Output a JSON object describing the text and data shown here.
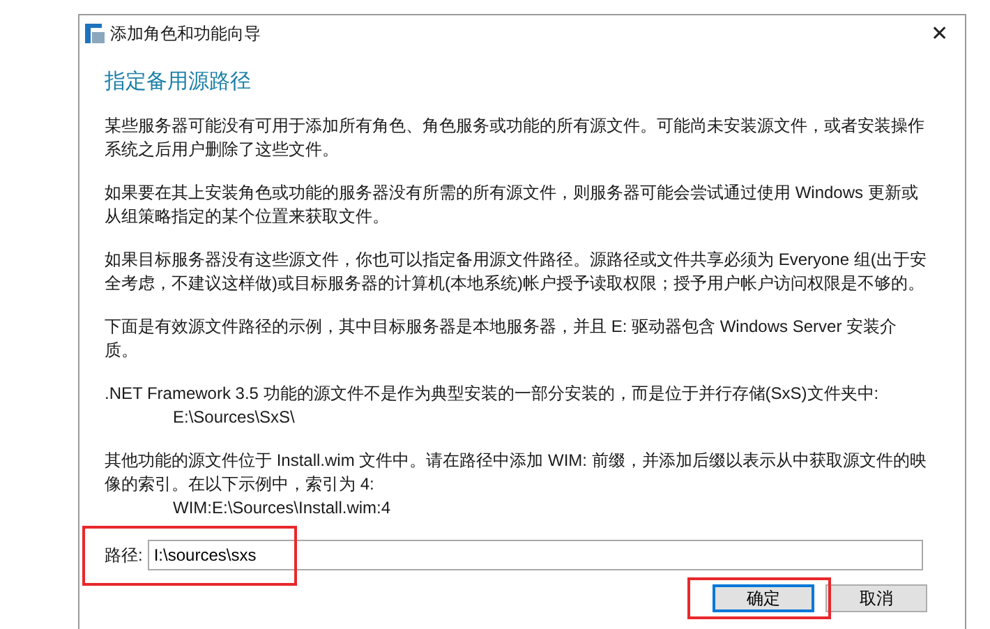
{
  "window": {
    "title": "添加角色和功能向导",
    "close": "✕"
  },
  "heading": "指定备用源路径",
  "paragraphs": [
    {
      "kind": "text",
      "text": "某些服务器可能没有可用于添加所有角色、角色服务或功能的所有源文件。可能尚未安装源文件，或者安装操作系统之后用户删除了这些文件。"
    },
    {
      "kind": "text",
      "text": "如果要在其上安装角色或功能的服务器没有所需的所有源文件，则服务器可能会尝试通过使用 Windows 更新或从组策略指定的某个位置来获取文件。"
    },
    {
      "kind": "text",
      "text": "如果目标服务器没有这些源文件，你也可以指定备用源文件路径。源路径或文件共享必须为 Everyone 组(出于安全考虑，不建议这样做)或目标服务器的计算机(本地系统)帐户授予读取权限；授予用户帐户访问权限是不够的。"
    },
    {
      "kind": "text",
      "text": "下面是有效源文件路径的示例，其中目标服务器是本地服务器，并且 E: 驱动器包含 Windows Server 安装介质。"
    },
    {
      "kind": "example",
      "text": ".NET Framework 3.5 功能的源文件不是作为典型安装的一部分安装的，而是位于并行存储(SxS)文件夹中:",
      "path": "E:\\Sources\\SxS\\"
    },
    {
      "kind": "example",
      "text": "其他功能的源文件位于 Install.wim 文件中。请在路径中添加 WIM: 前缀，并添加后缀以表示从中获取源文件的映像的索引。在以下示例中，索引为 4:",
      "path": "WIM:E:\\Sources\\Install.wim:4"
    }
  ],
  "path_field": {
    "label": "路径:",
    "value": "I:\\sources\\sxs",
    "highlighted": true
  },
  "buttons": [
    {
      "label": "确定",
      "default": true,
      "highlighted": true
    },
    {
      "label": "取消",
      "default": false,
      "highlighted": false
    }
  ]
}
